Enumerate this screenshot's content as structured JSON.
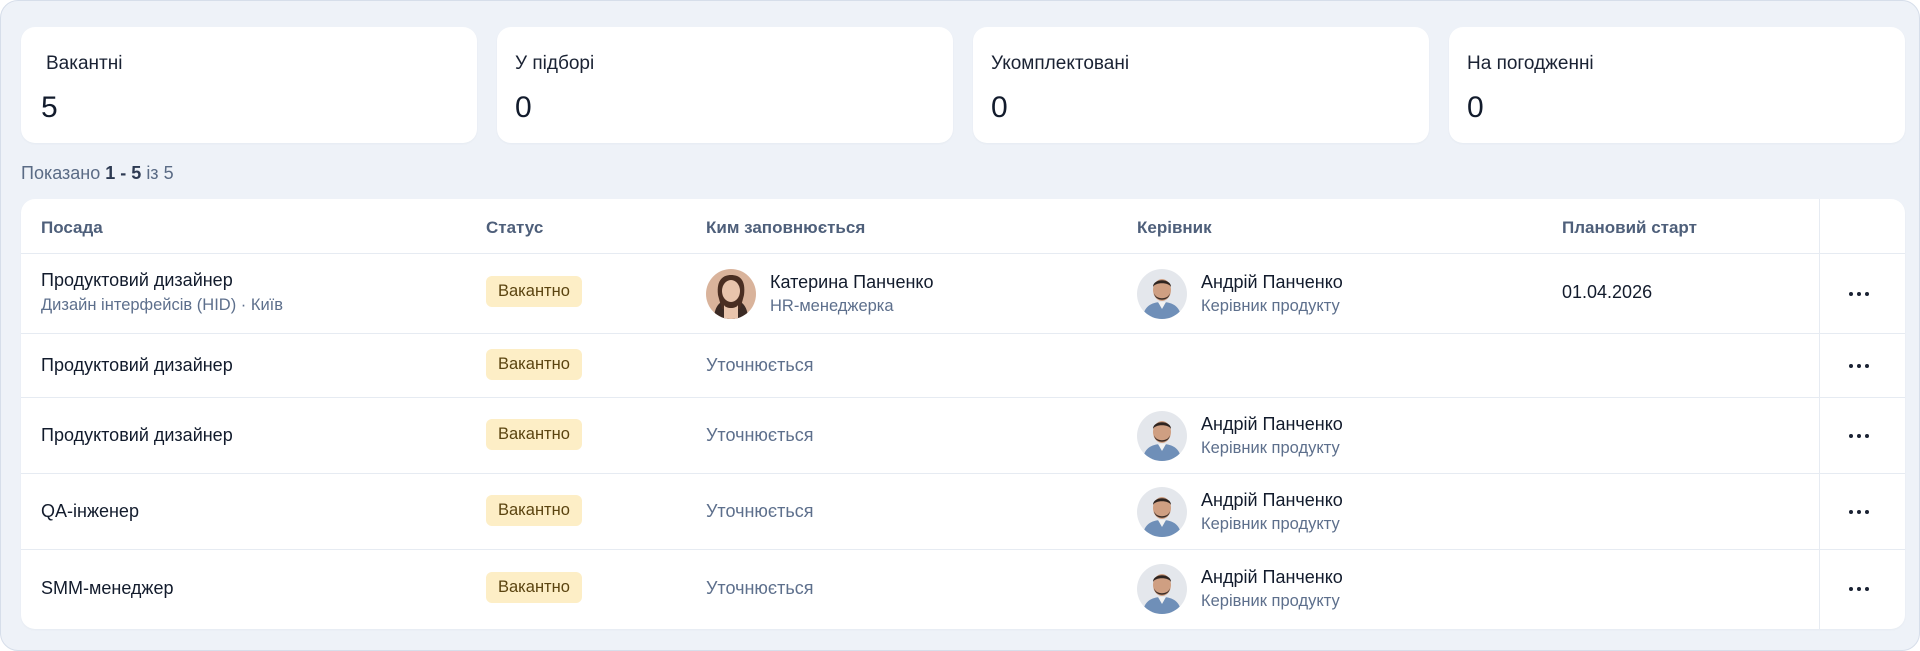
{
  "stats": [
    {
      "label": "Вакантні",
      "value": "5"
    },
    {
      "label": "У підборі",
      "value": "0"
    },
    {
      "label": "Укомплектовані",
      "value": "0"
    },
    {
      "label": "На погодженні",
      "value": "0"
    }
  ],
  "showing": {
    "prefix": "Показано",
    "range": "1 - 5",
    "of": "із",
    "total": "5"
  },
  "table": {
    "columns": {
      "position": "Посада",
      "status": "Статус",
      "filled_by": "Ким заповнюється",
      "manager": "Керівник",
      "start": "Плановий старт"
    },
    "rows": [
      {
        "position": "Продуктовий дизайнер",
        "subtitle": "Дизайн інтерфейсів (HID) · Київ",
        "status": "Вакантно",
        "filled_name": "Катерина Панченко",
        "filled_role": "HR-менеджерка",
        "filled_pending": "",
        "manager_name": "Андрій Панченко",
        "manager_role": "Керівник продукту",
        "start": "01.04.2026"
      },
      {
        "position": "Продуктовий дизайнер",
        "subtitle": "",
        "status": "Вакантно",
        "filled_name": "",
        "filled_role": "",
        "filled_pending": "Уточнюється",
        "manager_name": "",
        "manager_role": "",
        "start": ""
      },
      {
        "position": "Продуктовий дизайнер",
        "subtitle": "",
        "status": "Вакантно",
        "filled_name": "",
        "filled_role": "",
        "filled_pending": "Уточнюється",
        "manager_name": "Андрій Панченко",
        "manager_role": "Керівник продукту",
        "start": ""
      },
      {
        "position": "QA-інженер",
        "subtitle": "",
        "status": "Вакантно",
        "filled_name": "",
        "filled_role": "",
        "filled_pending": "Уточнюється",
        "manager_name": "Андрій Панченко",
        "manager_role": "Керівник продукту",
        "start": ""
      },
      {
        "position": "SMM-менеджер",
        "subtitle": "",
        "status": "Вакантно",
        "filled_name": "",
        "filled_role": "",
        "filled_pending": "Уточнюється",
        "manager_name": "Андрій Панченко",
        "manager_role": "Керівник продукту",
        "start": ""
      }
    ]
  },
  "icons": {
    "row_menu": "more-horizontal-icon",
    "avatar_female": "user-avatar-female",
    "avatar_male": "user-avatar-male"
  },
  "colors": {
    "badge_bg": "#fdeec6",
    "badge_text": "#5b4410",
    "muted_text": "#5d6f8c",
    "page_bg": "#eef2f8"
  }
}
